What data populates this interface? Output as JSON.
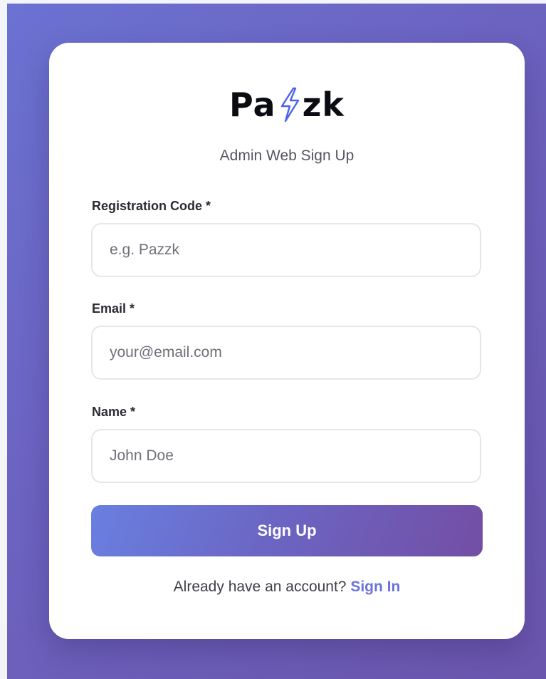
{
  "brand": {
    "logo_prefix": "Pa",
    "logo_suffix": "zk",
    "logo_icon": "lightning-bolt-icon",
    "subtitle": "Admin Web Sign Up"
  },
  "form": {
    "registration_code": {
      "label": "Registration Code *",
      "placeholder": "e.g. Pazzk",
      "value": ""
    },
    "email": {
      "label": "Email *",
      "placeholder": "your@email.com",
      "value": ""
    },
    "name": {
      "label": "Name *",
      "placeholder": "John Doe",
      "value": ""
    },
    "submit_label": "Sign Up"
  },
  "footer": {
    "prompt": "Already have an account?",
    "link_label": "Sign In"
  },
  "colors": {
    "background_gradient": [
      "#6b72d2",
      "#6b56ad"
    ],
    "button_gradient": [
      "#6a7fe0",
      "#734ea4"
    ],
    "logo_bolt": "#4d64e8",
    "link": "#6a74dc"
  }
}
